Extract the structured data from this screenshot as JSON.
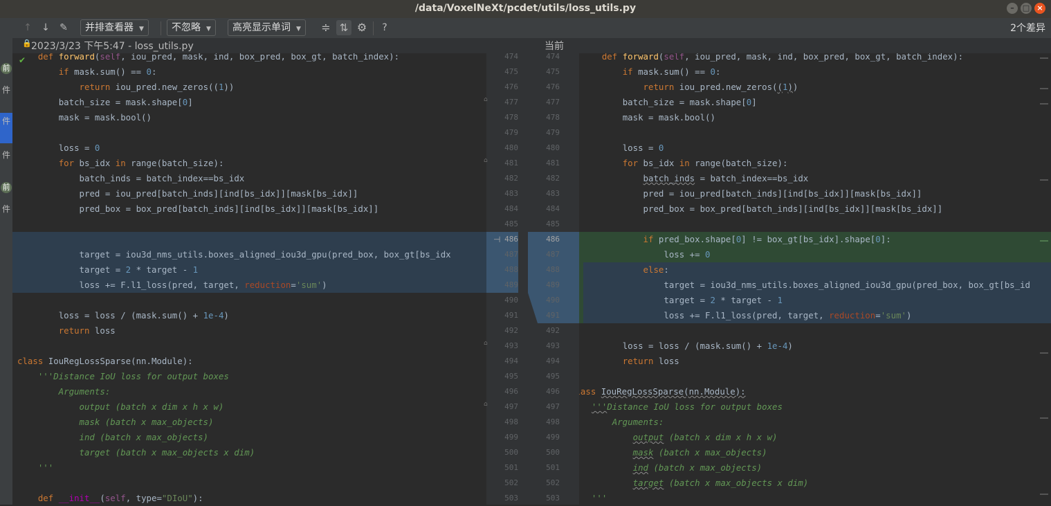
{
  "window": {
    "title": "/data/VoxelNeXt/pcdet/utils/loss_utils.py",
    "buttons": [
      "–",
      "□",
      "×"
    ]
  },
  "toolbar": {
    "prev_icon": "↑",
    "next_icon": "↓",
    "edit_icon": "✎",
    "viewer_label": "并排查看器",
    "ignore_label": "不忽略",
    "highlight_label": "高亮显示单词",
    "collapse_icon": "≑",
    "sync_icon": "⇅",
    "settings_icon": "⚙",
    "help_label": "?",
    "diff_count": "2个差异"
  },
  "left_strip": {
    "items": [
      "前",
      "件",
      "件",
      "件",
      "前",
      "件"
    ]
  },
  "left_header": {
    "lock_icon": "🔒",
    "label": "2023/3/23 下午5:47 - loss_utils.py"
  },
  "right_header": {
    "label": "当前"
  },
  "gutter": {
    "left_numbers": [
      "474",
      "475",
      "476",
      "477",
      "478",
      "479",
      "480",
      "481",
      "482",
      "483",
      "484",
      "485",
      "486",
      "487",
      "488",
      "489",
      "490",
      "491",
      "492",
      "493",
      "494",
      "495",
      "496",
      "497",
      "498",
      "499",
      "500",
      "501",
      "502",
      "503"
    ],
    "right_numbers": [
      "474",
      "475",
      "476",
      "477",
      "478",
      "479",
      "480",
      "481",
      "482",
      "483",
      "484",
      "485",
      "486",
      "487",
      "488",
      "489",
      "490",
      "491",
      "492",
      "493",
      "494",
      "495",
      "496",
      "497",
      "498",
      "499",
      "500",
      "501",
      "502",
      "503"
    ]
  },
  "colors": {
    "changed_bg": "#2e3e4e",
    "inserted_bg": "#2f4a34",
    "gutter_changed": "#3b5670"
  }
}
